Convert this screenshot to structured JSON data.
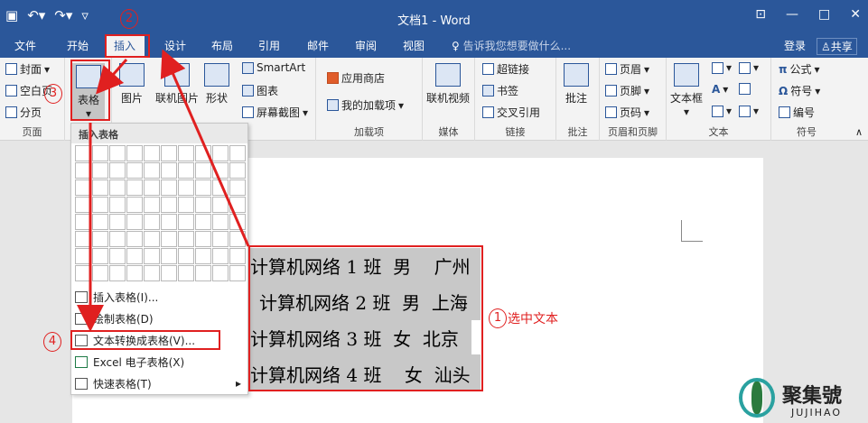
{
  "titlebar": {
    "title": "文档1 - Word",
    "save_icon": "save-icon",
    "undo_icon": "undo-icon",
    "redo_icon": "redo-icon",
    "customize_icon": "customize-icon",
    "minimize": "—",
    "restore": "□",
    "close": "✕",
    "ribbon_display": "⊡"
  },
  "tabs": [
    "文件",
    "开始",
    "插入",
    "设计",
    "布局",
    "引用",
    "邮件",
    "审阅",
    "视图"
  ],
  "tellme": "告诉我您想要做什么...",
  "login": "登录",
  "share": "共享",
  "ribbon": {
    "pages": {
      "cover": "封面",
      "blank": "空白页",
      "break": "分页",
      "label": "页面"
    },
    "table_btn": "表格",
    "illustrations": {
      "picture": "图片",
      "online_picture": "联机图片",
      "shapes": "形状",
      "smartart": "SmartArt",
      "chart": "图表",
      "screenshot": "屏幕截图"
    },
    "addins": {
      "store": "应用商店",
      "my_addins": "我的加载项",
      "label": "加载项"
    },
    "media": {
      "online_video": "联机视频",
      "label": "媒体"
    },
    "links": {
      "hyperlink": "超链接",
      "bookmark": "书签",
      "crossref": "交叉引用",
      "label": "链接"
    },
    "comments": {
      "comment": "批注",
      "label": "批注"
    },
    "headerfooter": {
      "header": "页眉",
      "footer": "页脚",
      "pagenum": "页码",
      "label": "页眉和页脚"
    },
    "text": {
      "textbox": "文本框",
      "label": "文本"
    },
    "symbols": {
      "equation": "公式",
      "symbol": "符号",
      "number": "编号",
      "label": "符号"
    }
  },
  "dropdown": {
    "header": "插入表格",
    "items": [
      "插入表格(I)...",
      "绘制表格(D)",
      "文本转换成表格(V)...",
      "Excel 电子表格(X)",
      "快速表格(T)"
    ]
  },
  "selection_lines": [
    "计算机网络 1 班  男    广州",
    "计算机网络 2 班  男  上海",
    "计算机网络 3 班  女  北京",
    "计算机网络 4 班    女  汕头"
  ],
  "annotations": {
    "n1": "1",
    "n2": "2",
    "n3": "3",
    "n4": "4",
    "select_text": "选中文本"
  },
  "logo": {
    "cn": "聚集號",
    "en": "JUJIHAO"
  }
}
